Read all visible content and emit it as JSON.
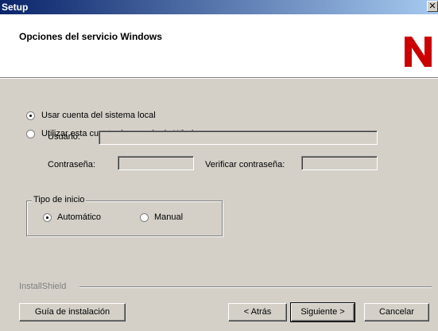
{
  "window": {
    "title": "Setup"
  },
  "header": {
    "title": "Opciones del servicio Windows",
    "logo_letter": "N",
    "logo_color": "#cc0000"
  },
  "account": {
    "option_local": "Usar cuenta del sistema local",
    "option_user": "Utilizar esta cuenta de usuario de Windows:",
    "selected": "local",
    "usuario_label": "Usuario:",
    "usuario_value": "",
    "password_label": "Contraseña:",
    "password_value": "",
    "verify_label": "Verificar contraseña:",
    "verify_value": ""
  },
  "startup": {
    "group_label": "Tipo de inicio",
    "option_auto": "Automático",
    "option_manual": "Manual",
    "selected": "auto"
  },
  "footer": {
    "brand": "InstallShield",
    "guide_button": "Guía de instalación",
    "back_button": "< Atrás",
    "next_button": "Siguiente >",
    "cancel_button": "Cancelar"
  }
}
